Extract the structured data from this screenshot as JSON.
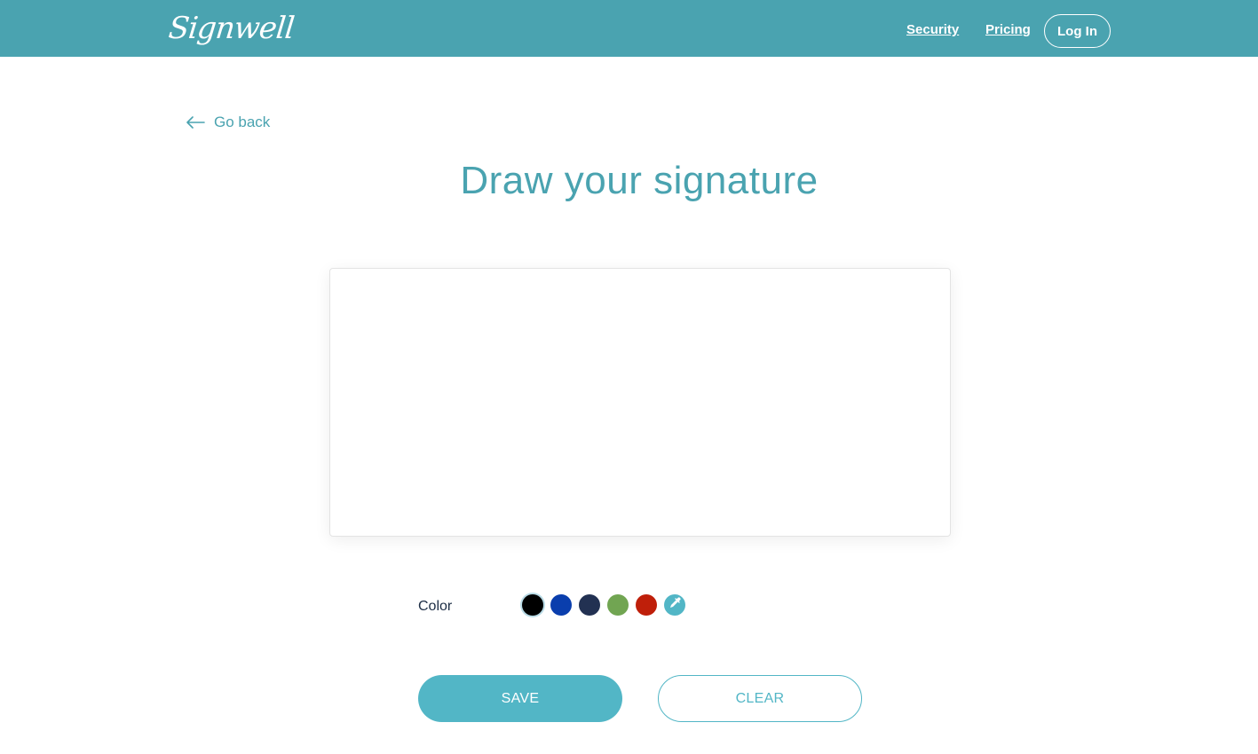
{
  "header": {
    "logo": "Signwell",
    "nav": [
      {
        "label": "Security"
      },
      {
        "label": "Pricing"
      }
    ],
    "login_label": "Log In",
    "background": "#4aa3b0"
  },
  "back_link": {
    "icon": "arrow-left-icon",
    "label": "Go back"
  },
  "page_title": "Draw your signature",
  "signature_pad": {
    "empty": true
  },
  "color_picker": {
    "label": "Color",
    "selected": "black",
    "swatches": [
      {
        "name": "black",
        "color": "#000000"
      },
      {
        "name": "blue",
        "color": "#0a3ead"
      },
      {
        "name": "navy",
        "color": "#223152"
      },
      {
        "name": "green",
        "color": "#71a552"
      },
      {
        "name": "red",
        "color": "#bf1f0a"
      }
    ],
    "custom_picker": {
      "icon": "eyedropper-icon",
      "color": "#52b6c6"
    }
  },
  "actions": {
    "save_label": "SAVE",
    "clear_label": "CLEAR"
  }
}
